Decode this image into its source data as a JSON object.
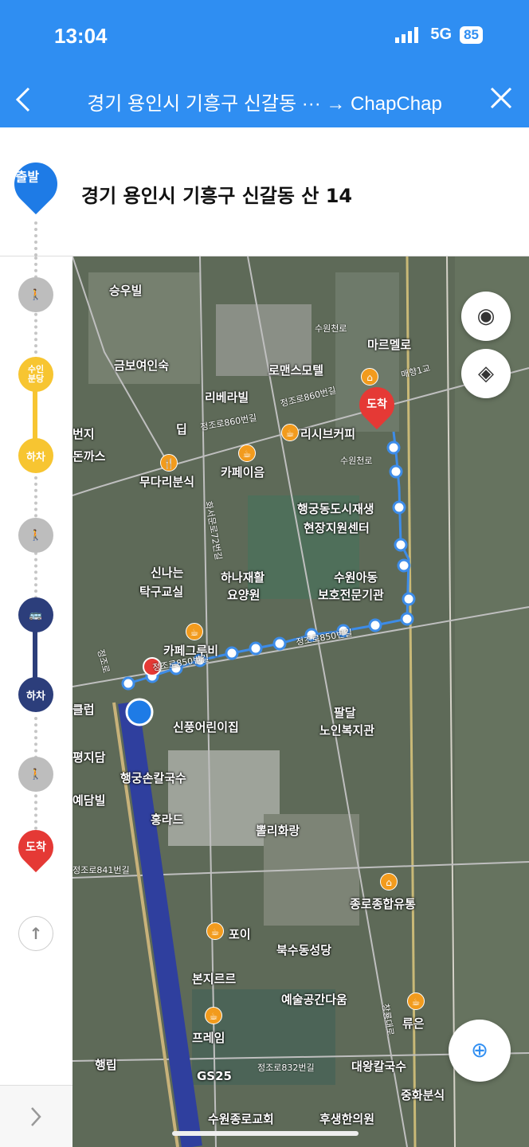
{
  "status": {
    "time": "13:04",
    "network": "5G",
    "battery": "85"
  },
  "header": {
    "title": "경기 용인시 기흥구 신갈동 ··· → ChapChap"
  },
  "origin": {
    "pin_label": "출발",
    "address": "경기 용인시 기흥구 신갈동 산 14"
  },
  "steps": {
    "transfer": "수인\n분당",
    "alight": "하차",
    "bus_alight": "하차",
    "arrive": "도착"
  },
  "map": {
    "destination_pin": "도착",
    "places": [
      "승우빌",
      "금보여인숙",
      "리베라빌",
      "로맨스모텔",
      "마르멜로",
      "리시브커피",
      "카페이음",
      "무다리분식",
      "행궁동도시재생",
      "현장지원센터",
      "수원아동",
      "보호전문기관",
      "신나는",
      "탁구교실",
      "하나재활",
      "요양원",
      "카페그루비",
      "신풍어린이집",
      "팔달",
      "노인복지관",
      "행궁손칼국수",
      "홍라드",
      "뽈리화랑",
      "종로종합유통",
      "포이",
      "북수동성당",
      "본지르르",
      "예술공간다움",
      "프레임",
      "류은",
      "GS25",
      "대왕칼국수",
      "중화분식",
      "수원종로교회",
      "후생한의원",
      "클럽",
      "평지담",
      "예담빌",
      "행립",
      "번지",
      "돈까스",
      "딥"
    ],
    "roads": [
      "정조로860번길",
      "정조로860번길",
      "수원천로",
      "매향1교",
      "정조로850번길",
      "정조로850번길",
      "화서문로72번길",
      "정조로841번길",
      "창룡대로",
      "정조로832번길",
      "정조로",
      "수원천로"
    ]
  },
  "colors": {
    "header": "#2f8ef2",
    "walk": "#bdbdbd",
    "subway": "#f7c531",
    "bus": "#2c3e7b",
    "arrive": "#e53935",
    "origin": "#1e7be6"
  }
}
